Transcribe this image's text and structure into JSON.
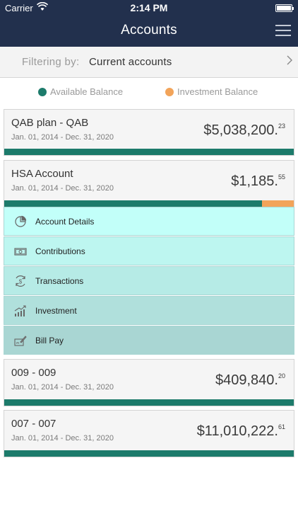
{
  "status_bar": {
    "carrier": "Carrier",
    "time": "2:14 PM"
  },
  "header": {
    "title": "Accounts"
  },
  "filter": {
    "label": "Filtering by:",
    "value": "Current accounts"
  },
  "legend": {
    "available": {
      "label": "Available Balance",
      "color": "#1d7b6b"
    },
    "investment": {
      "label": "Investment Balance",
      "color": "#f2a45a"
    }
  },
  "accounts": [
    {
      "name": "QAB plan - QAB",
      "dates": "Jan. 01, 2014 - Dec. 31, 2020",
      "amount_main": "$5,038,200.",
      "amount_cents": "23",
      "available_fraction": 1.0,
      "investment_fraction": 0.0
    },
    {
      "name": "HSA Account",
      "dates": "Jan. 01, 2014 - Dec. 31, 2020",
      "amount_main": "$1,185.",
      "amount_cents": "55",
      "available_fraction": 0.89,
      "investment_fraction": 0.11
    },
    {
      "name": "009 - 009",
      "dates": "Jan. 01, 2014 - Dec. 31, 2020",
      "amount_main": "$409,840.",
      "amount_cents": "20",
      "available_fraction": 1.0,
      "investment_fraction": 0.0
    },
    {
      "name": "007 - 007",
      "dates": "Jan. 01, 2014 - Dec. 31, 2020",
      "amount_main": "$11,010,222.",
      "amount_cents": "61",
      "available_fraction": 1.0,
      "investment_fraction": 0.0
    }
  ],
  "submenu": [
    {
      "label": "Account Details",
      "icon": "pie-chart-icon",
      "color": "#c2fff9"
    },
    {
      "label": "Contributions",
      "icon": "cash-icon",
      "color": "#bdf6f0"
    },
    {
      "label": "Transactions",
      "icon": "dollar-cycle-icon",
      "color": "#b6ebe6"
    },
    {
      "label": "Investment",
      "icon": "growth-chart-icon",
      "color": "#b0e0dc"
    },
    {
      "label": "Bill Pay",
      "icon": "check-sign-icon",
      "color": "#a9d6d3"
    }
  ]
}
